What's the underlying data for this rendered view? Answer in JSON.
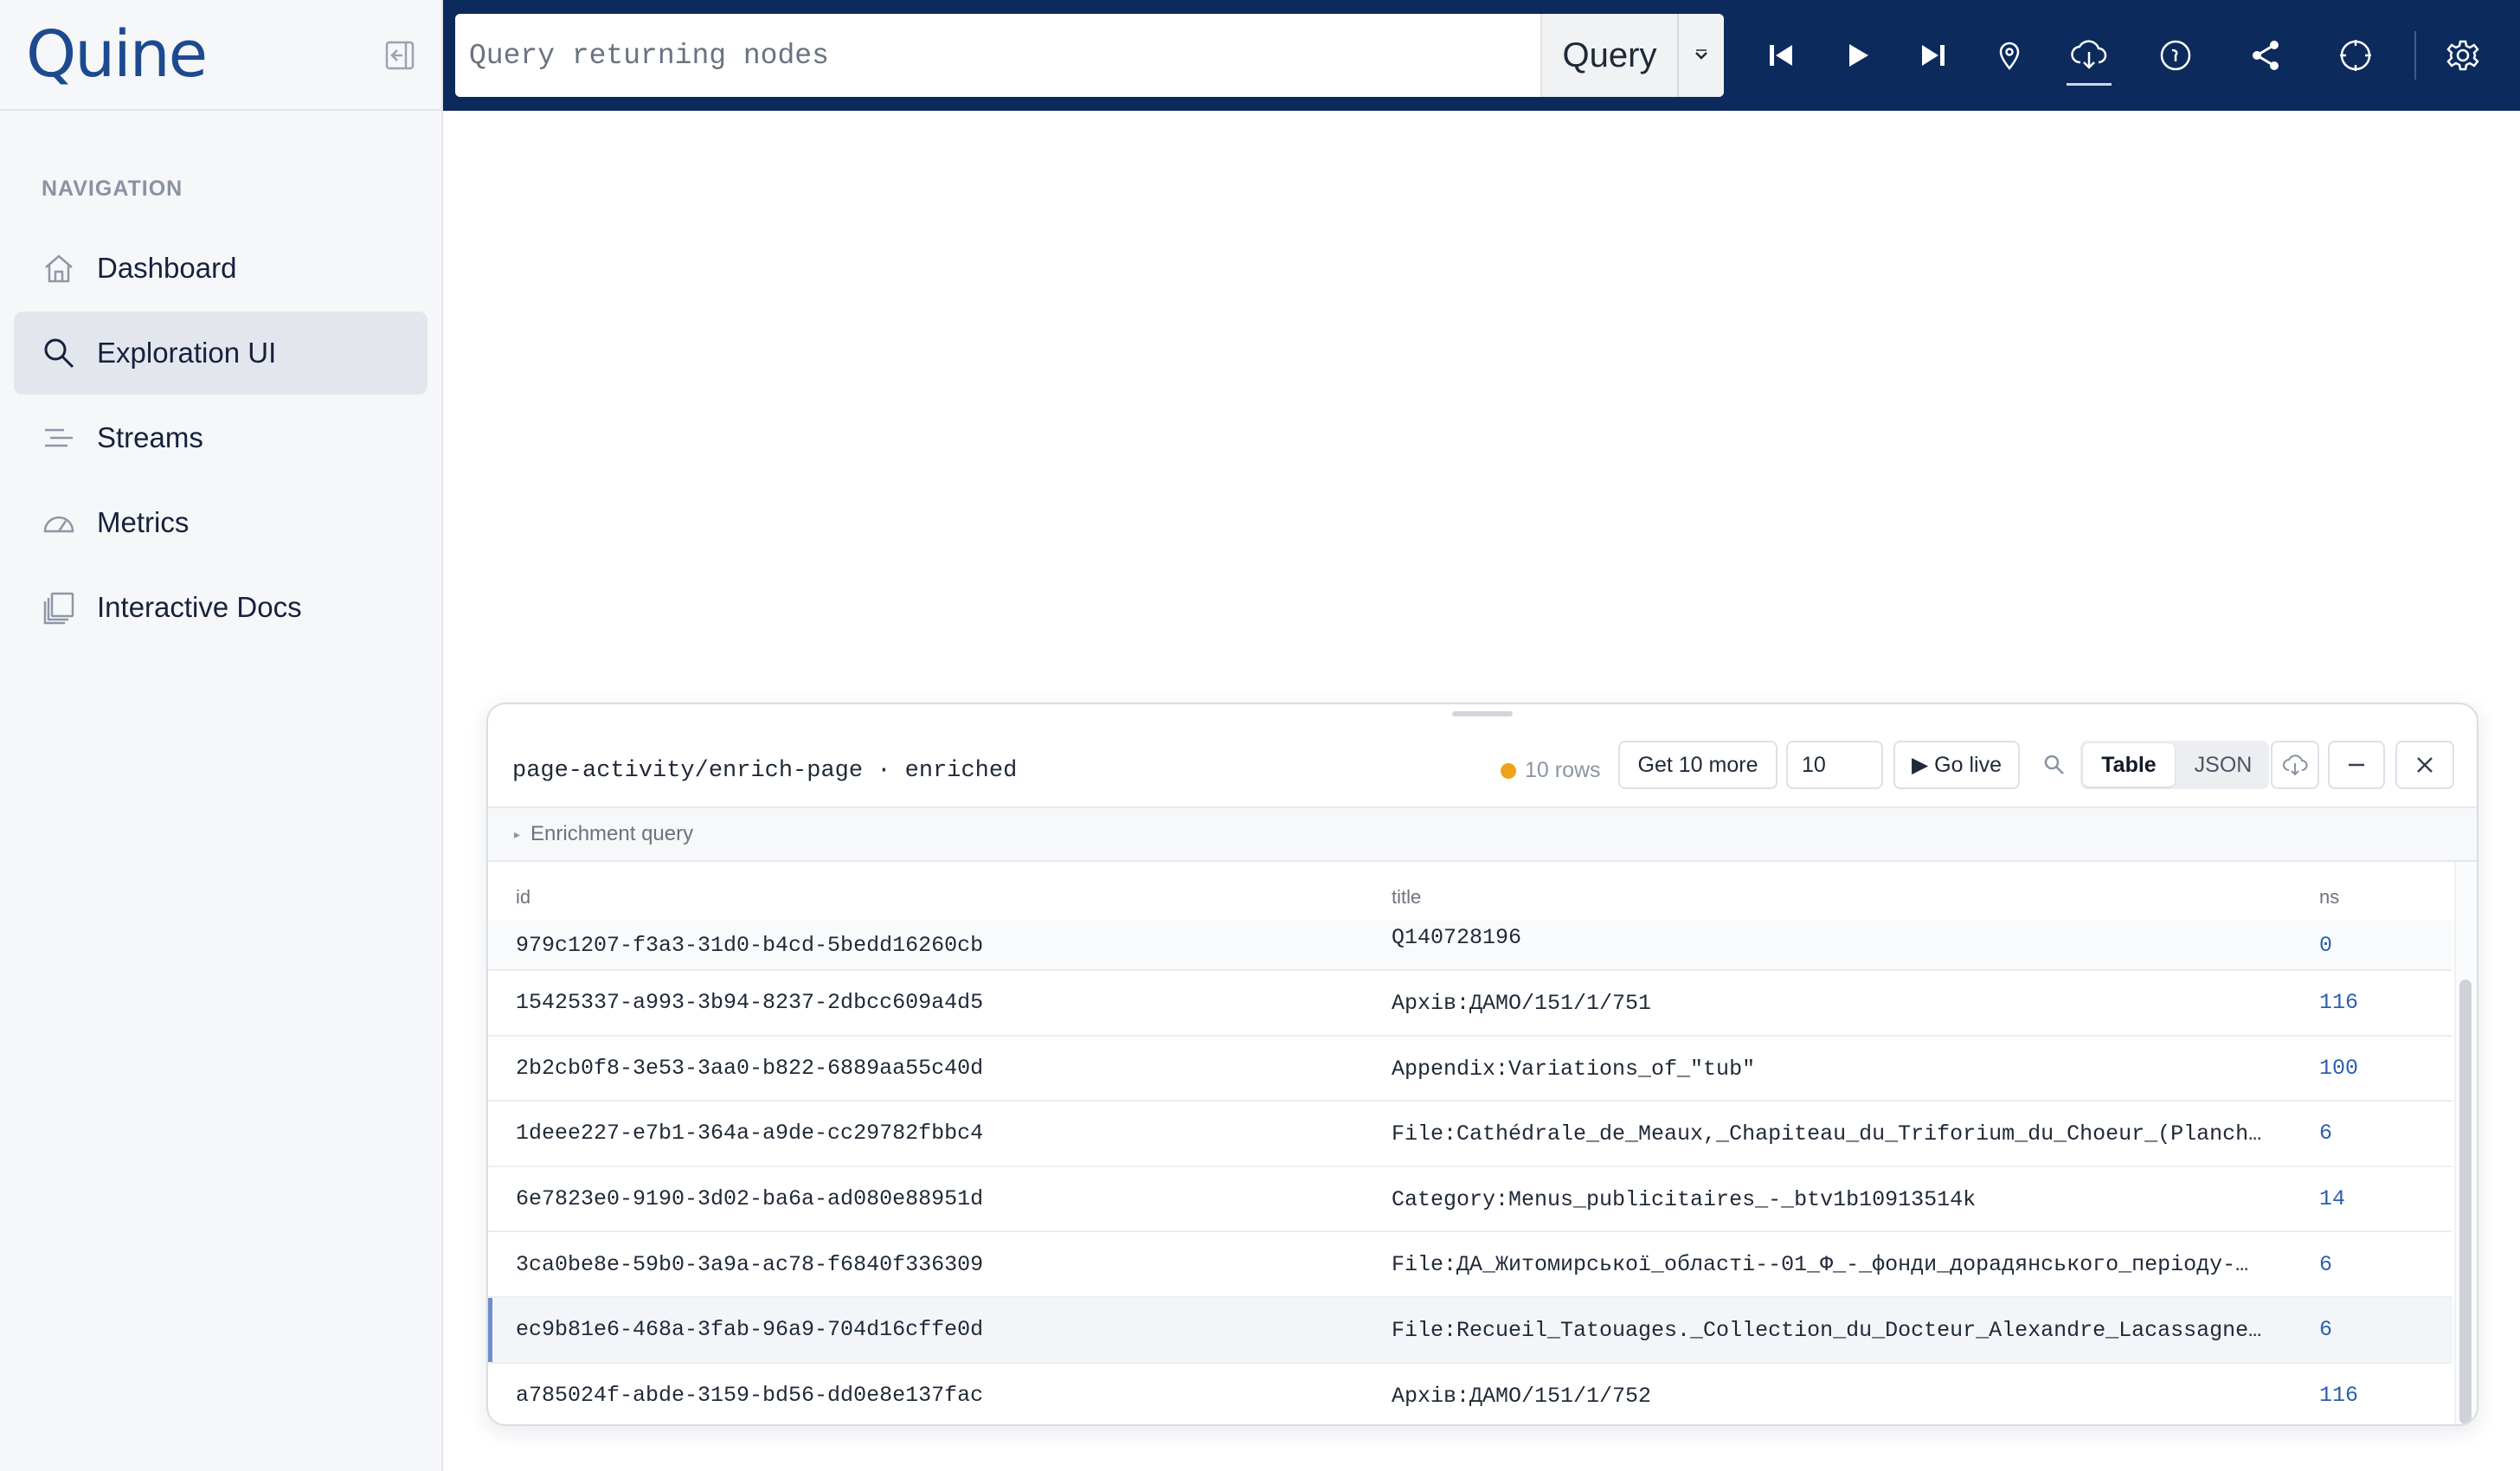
{
  "brand": {
    "name": "Quine"
  },
  "sidebar": {
    "heading": "NAVIGATION",
    "items": [
      {
        "label": "Dashboard",
        "icon": "home-icon",
        "active": false
      },
      {
        "label": "Exploration UI",
        "icon": "search-icon",
        "active": true
      },
      {
        "label": "Streams",
        "icon": "streams-icon",
        "active": false
      },
      {
        "label": "Metrics",
        "icon": "gauge-icon",
        "active": false
      },
      {
        "label": "Interactive Docs",
        "icon": "docs-icon",
        "active": false
      }
    ]
  },
  "topbar": {
    "query_placeholder": "Query returning nodes",
    "query_value": "",
    "query_button": "Query",
    "icons": [
      "skip-back-icon",
      "play-icon",
      "skip-forward-icon",
      "map-pin-icon",
      "cloud-download-icon",
      "info-icon",
      "share-icon",
      "crosshair-icon",
      "gear-icon"
    ]
  },
  "panel": {
    "title": "page-activity/enrich-page · enriched",
    "rows_badge": "10 rows",
    "get_more_label": "Get 10 more",
    "count_value": "10",
    "go_live_label": "▶ Go live",
    "view_table": "Table",
    "view_json": "JSON",
    "enrichment_label": "Enrichment query",
    "columns": [
      "id",
      "title",
      "ns"
    ],
    "rows": [
      {
        "id": "979c1207-f3a3-31d0-b4cd-5bedd16260cb",
        "title": "Q140728196",
        "ns": "0"
      },
      {
        "id": "15425337-a993-3b94-8237-2dbcc609a4d5",
        "title": "Архів:ДАМО/151/1/751",
        "ns": "116"
      },
      {
        "id": "2b2cb0f8-3e53-3aa0-b822-6889aa55c40d",
        "title": "Appendix:Variations_of_\"tub\"",
        "ns": "100"
      },
      {
        "id": "1deee227-e7b1-364a-a9de-cc29782fbbc4",
        "title": "File:Cathédrale_de_Meaux,_Chapiteau_du_Triforium_du_Choeur_(Planch…",
        "ns": "6"
      },
      {
        "id": "6e7823e0-9190-3d02-ba6a-ad080e88951d",
        "title": "Category:Menus_publicitaires_-_btv1b10913514k",
        "ns": "14"
      },
      {
        "id": "3ca0be8e-59b0-3a9a-ac78-f6840f336309",
        "title": "File:ДА_Житомирської_області--01_Ф_-_фонди_дорадянського_періоду-…",
        "ns": "6"
      },
      {
        "id": "ec9b81e6-468a-3fab-96a9-704d16cffe0d",
        "title": "File:Recueil_Tatouages._Collection_du_Docteur_Alexandre_Lacassagne…",
        "ns": "6"
      },
      {
        "id": "a785024f-abde-3159-bd56-dd0e8e137fac",
        "title": "Архів:ДАМО/151/1/752",
        "ns": "116"
      }
    ]
  },
  "colors": {
    "topbar": "#0c2a5c",
    "brand": "#1d4a8f",
    "accent": "#2b5fae",
    "status_dot": "#f0a21a"
  }
}
